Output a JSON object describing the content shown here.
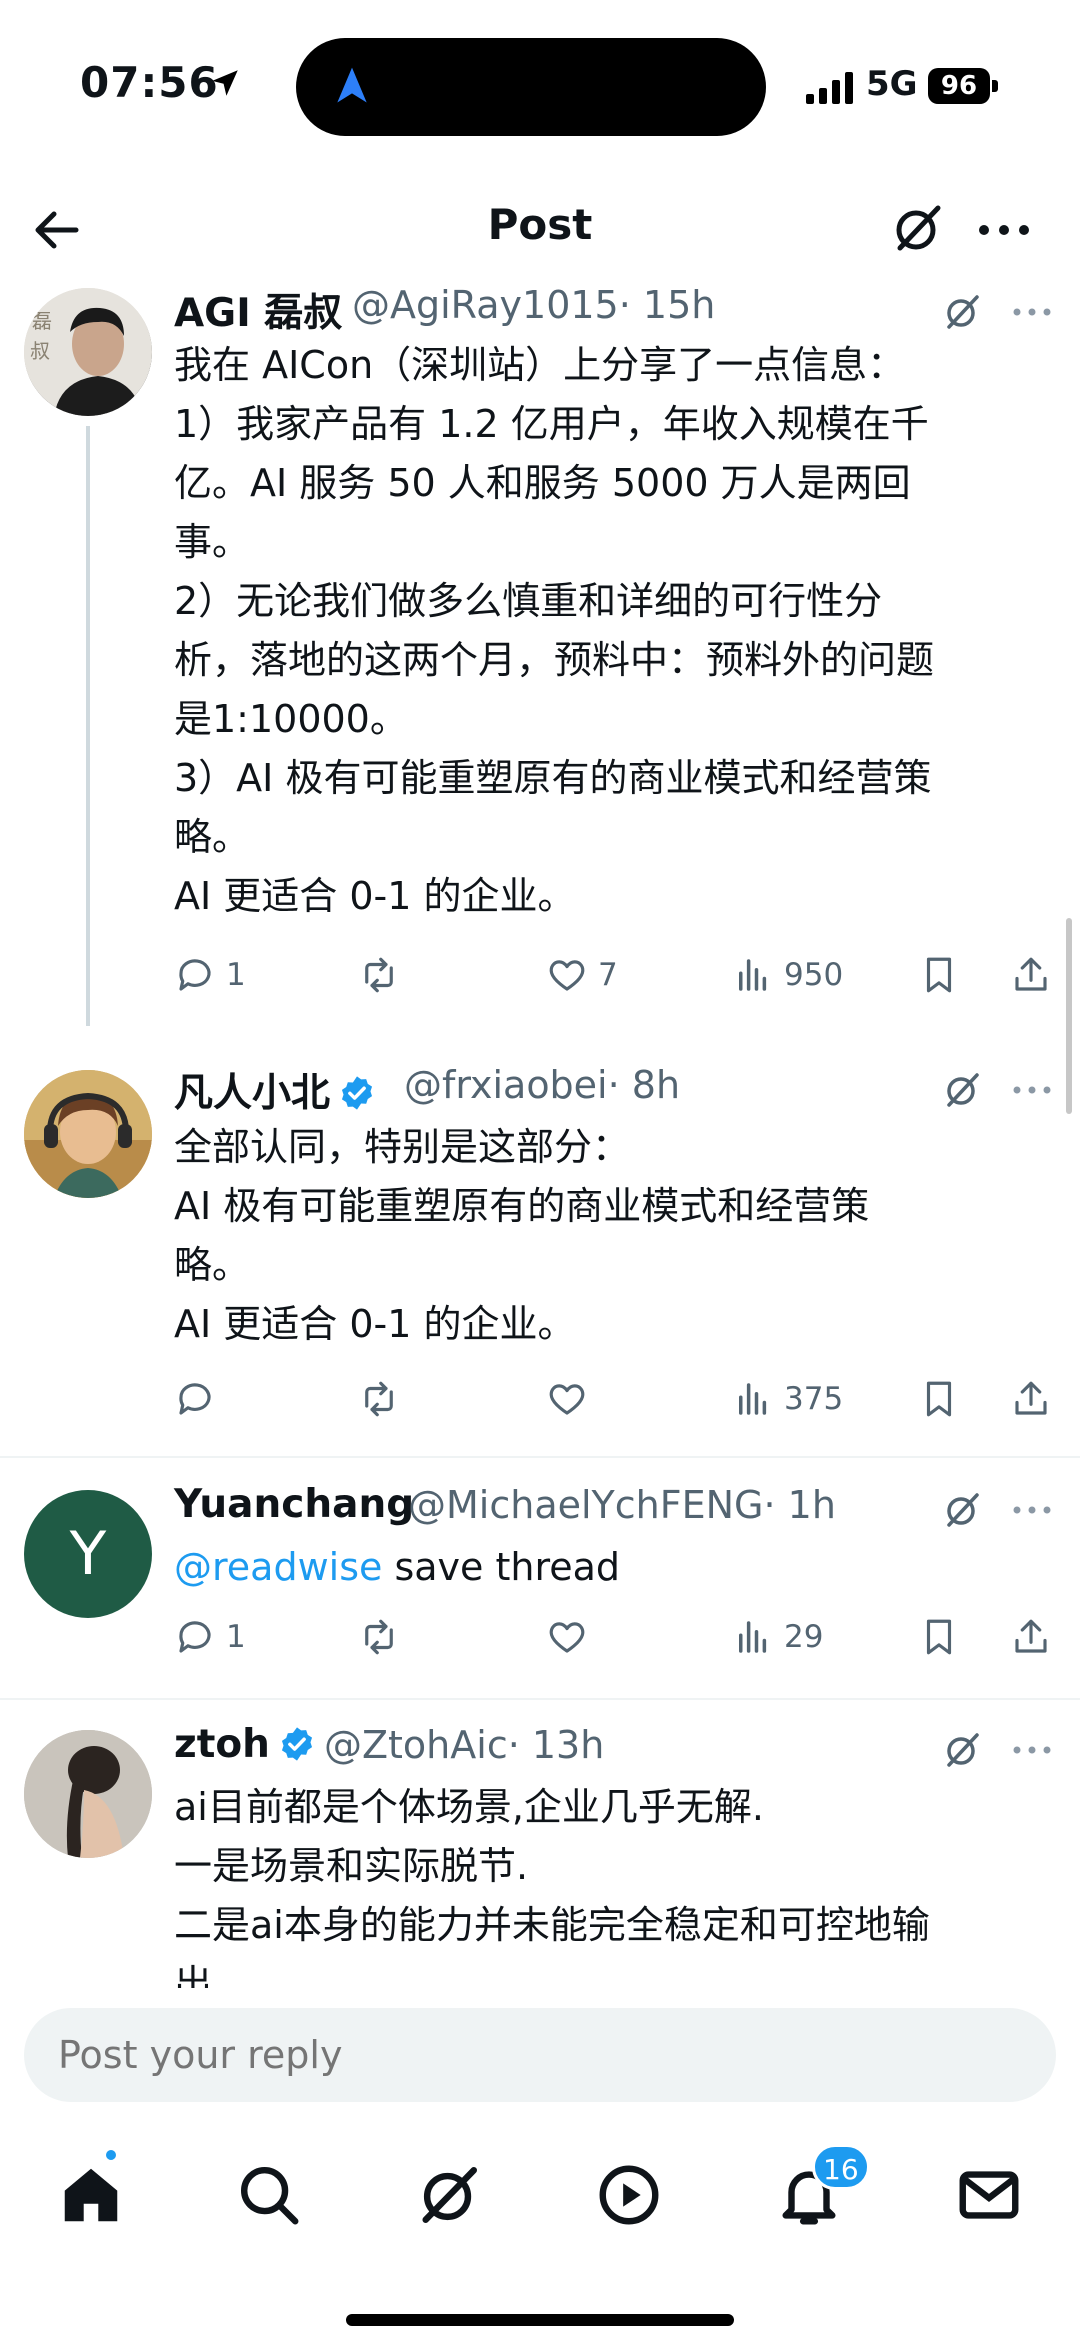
{
  "status_bar": {
    "time": "07:56",
    "network": "5G",
    "battery": "96"
  },
  "header": {
    "title": "Post"
  },
  "tweets": [
    {
      "name": "AGI 磊叔",
      "handle": "@AgiRay1015",
      "time": "· 15h",
      "body": [
        "我在 AICon（深圳站）上分享了一点信息：",
        "1）我家产品有 1.2 亿用户，年收入规模在千",
        "亿。AI 服务 50 人和服务 5000 万人是两回",
        "事。",
        "2）无论我们做多么慎重和详细的可行性分",
        "析，落地的这两个月，预料中：预料外的问题",
        "是1:10000。",
        "3）AI 极有可能重塑原有的商业模式和经营策",
        "略。",
        "AI 更适合 0-1 的企业。"
      ],
      "stats": {
        "replies": "1",
        "reposts": "",
        "likes": "7",
        "views": "950"
      }
    },
    {
      "name": "凡人小北",
      "handle": "@frxiaobei",
      "time": "· 8h",
      "body": [
        "全部认同，特别是这部分：",
        "AI 极有可能重塑原有的商业模式和经营策",
        "略。",
        "AI 更适合 0-1 的企业。"
      ],
      "stats": {
        "replies": "",
        "reposts": "",
        "likes": "",
        "views": "375"
      }
    },
    {
      "name": "Yuanchang",
      "handle": "@MichaelYchFENG",
      "time": "· 1h",
      "avatar_letter": "Y",
      "mention": "@readwise",
      "body_text": " save thread",
      "stats": {
        "replies": "1",
        "reposts": "",
        "likes": "",
        "views": "29"
      }
    },
    {
      "name": "ztoh",
      "handle": "@ZtohAic",
      "time": "· 13h",
      "body": [
        "ai目前都是个体场景,企业几乎无解.",
        "一是场景和实际脱节.",
        "二是ai本身的能力并未能完全稳定和可控地输",
        "出"
      ]
    }
  ],
  "reply": {
    "placeholder": "Post your reply"
  },
  "nav": {
    "notifications_badge": "16"
  },
  "colors": {
    "accent": "#1d9bf0",
    "text": "#0f1419",
    "secondary": "#536471",
    "avatar_green": "#1f5b45"
  },
  "icons": [
    "back-arrow-icon",
    "grok-icon",
    "more-icon",
    "reply-icon",
    "repost-icon",
    "like-icon",
    "views-icon",
    "bookmark-icon",
    "share-icon",
    "home-icon",
    "search-icon",
    "play-icon",
    "bell-icon",
    "mail-icon",
    "verified-icon"
  ]
}
